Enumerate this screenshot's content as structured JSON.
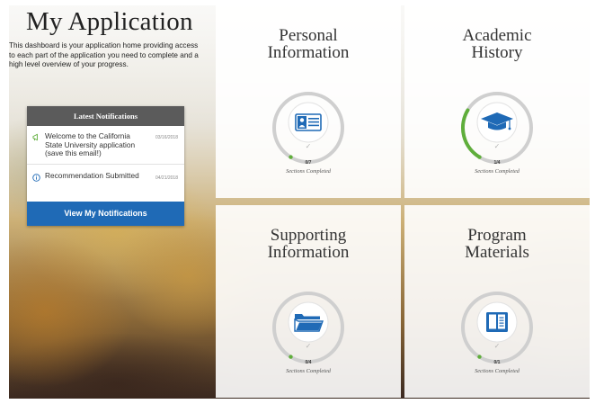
{
  "page": {
    "title": "My Application",
    "intro": "This dashboard is your application home providing access to each part of the application you need to complete and a high level overview of your progress."
  },
  "notifications": {
    "header": "Latest Notifications",
    "items": [
      {
        "text": "Welcome to the California State University application (save this email!)",
        "date": "03/16/2018",
        "icon": "megaphone-icon"
      },
      {
        "text": "Recommendation Submitted",
        "date": "04/21/2018",
        "icon": "info-icon"
      }
    ],
    "button_label": "View My Notifications"
  },
  "sections": {
    "subtitle": "Sections Completed",
    "items": [
      {
        "title_line1": "Personal",
        "title_line2": "Information",
        "count": "0/7",
        "completed": 0,
        "total": 7,
        "icon": "id-card-icon"
      },
      {
        "title_line1": "Academic",
        "title_line2": "History",
        "count": "1/4",
        "completed": 1,
        "total": 4,
        "icon": "graduation-cap-icon"
      },
      {
        "title_line1": "Supporting",
        "title_line2": "Information",
        "count": "0/4",
        "completed": 0,
        "total": 4,
        "icon": "folder-icon"
      },
      {
        "title_line1": "Program",
        "title_line2": "Materials",
        "count": "0/1",
        "completed": 0,
        "total": 1,
        "icon": "book-icon"
      }
    ]
  },
  "colors": {
    "primary": "#1f6ab6",
    "progress": "#5fae3b",
    "track": "#cfcfcf",
    "header": "#5b5b5b"
  }
}
